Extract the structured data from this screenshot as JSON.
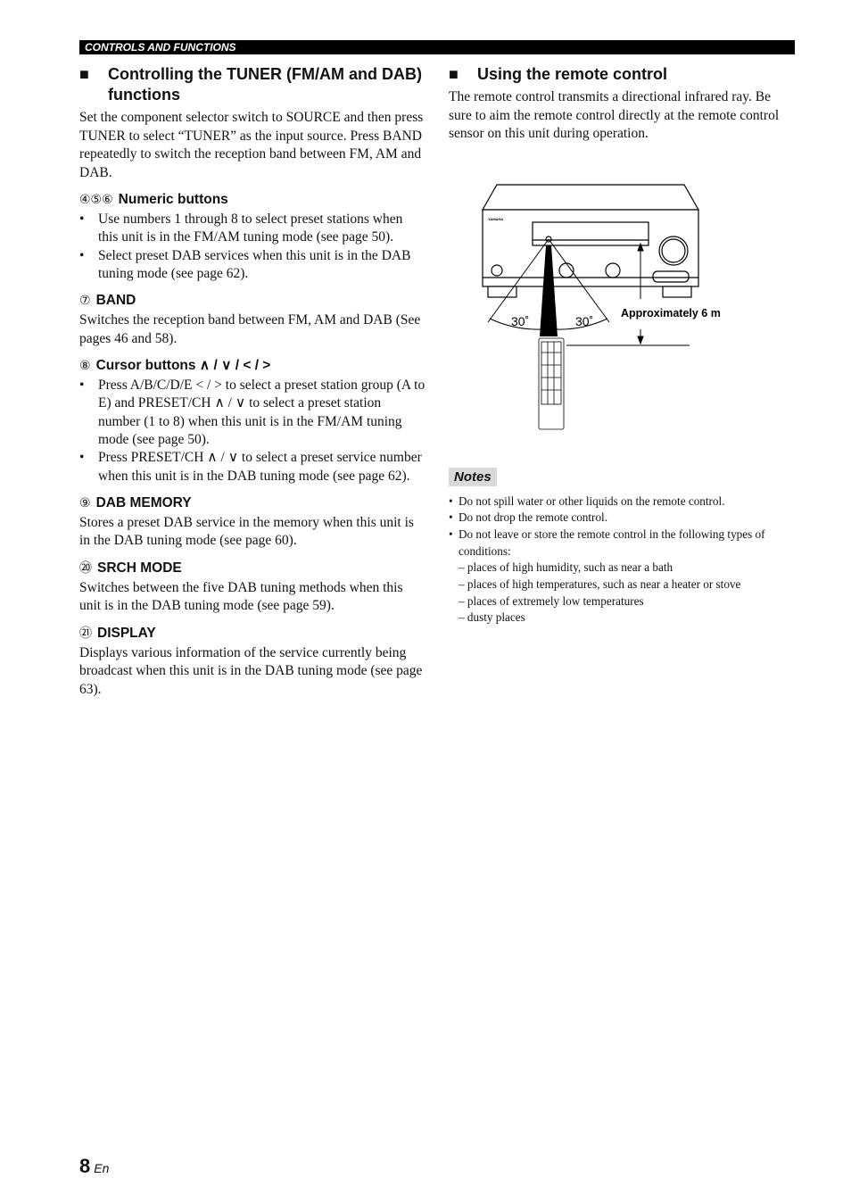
{
  "header": "CONTROLS AND FUNCTIONS",
  "left": {
    "title": "Controlling the TUNER (FM/AM and DAB) functions",
    "intro": "Set the component selector switch to SOURCE and then press TUNER to select “TUNER” as the input source. Press BAND repeatedly to switch the reception band between FM, AM and DAB.",
    "sections": [
      {
        "num": "④⑤⑥",
        "title": "Numeric buttons",
        "bullets": [
          "Use numbers 1 through 8 to select preset stations when this unit is in the FM/AM tuning mode (see page 50).",
          "Select preset DAB services when this unit is in the DAB tuning mode (see page 62)."
        ]
      },
      {
        "num": "⑦",
        "title": "BAND",
        "text": "Switches the reception band between FM, AM and DAB (See pages 46 and 58)."
      },
      {
        "num": "⑧",
        "title": "Cursor buttons ∧ / ∨ / < / >",
        "bullets": [
          "Press A/B/C/D/E < / > to select a preset station group (A to E) and PRESET/CH ∧ / ∨ to select a preset station number (1 to 8) when this unit is in the FM/AM tuning mode (see page 50).",
          "Press PRESET/CH ∧ / ∨ to select a preset service number when this unit is in the DAB tuning mode (see page 62)."
        ]
      },
      {
        "num": "⑨",
        "title": "DAB MEMORY",
        "text": "Stores a preset DAB service in the memory when this unit is in the DAB tuning mode (see page 60)."
      },
      {
        "num": "⑳",
        "title": "SRCH MODE",
        "text": "Switches between the five DAB tuning methods when this unit is in the DAB tuning mode (see page 59)."
      },
      {
        "num": "㉑",
        "title": "DISPLAY",
        "text": "Displays various information of the service currently being broadcast when this unit is in the DAB tuning mode (see page 63)."
      }
    ]
  },
  "right": {
    "title": "Using the remote control",
    "intro": "The remote control transmits a directional infrared ray. Be sure to aim the remote control directly at the remote control sensor on this unit during operation.",
    "diagram": {
      "angle_left": "30˚",
      "angle_right": "30˚",
      "distance": "Approximately 6 m",
      "brand_logo": "YAMAHA"
    },
    "notes_title": "Notes",
    "notes": [
      "Do not spill water or other liquids on the remote control.",
      "Do not drop the remote control.",
      "Do not leave or store the remote control in the following types of conditions:"
    ],
    "subnotes": [
      "– places of high humidity, such as near a bath",
      "– places of high temperatures, such as near a heater or stove",
      "– places of extremely low temperatures",
      "– dusty places"
    ]
  },
  "footer": {
    "page": "8",
    "lang": "En"
  }
}
